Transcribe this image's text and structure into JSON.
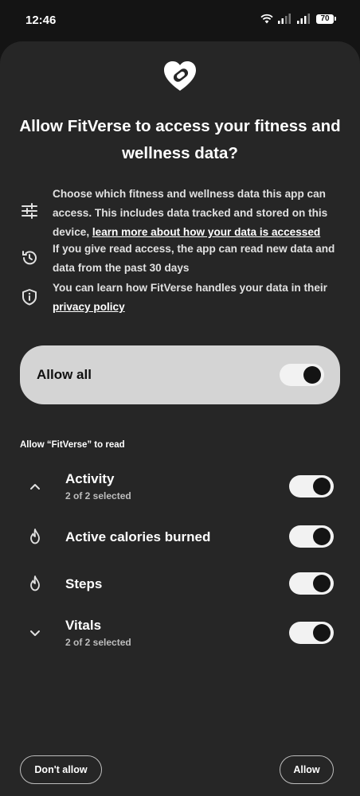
{
  "status_bar": {
    "time": "12:46",
    "battery_level": "70"
  },
  "dialog": {
    "title": "Allow FitVerse to access your fitness and wellness data?",
    "info": [
      {
        "icon": "sliders-icon",
        "text": "Choose which fitness and wellness data this app can access. This includes data tracked and stored on this device, ",
        "link": "learn more about how your data is accessed"
      },
      {
        "icon": "history-icon",
        "text": "If you give read access, the app can read new data and data from the past 30 days"
      },
      {
        "icon": "shield-icon",
        "text": "You can learn how FitVerse handles your data in their ",
        "link": "privacy policy"
      }
    ],
    "allow_all": {
      "label": "Allow all",
      "enabled": true
    },
    "section_label": "Allow “FitVerse” to read",
    "permissions": [
      {
        "icon": "chevron-up-icon",
        "title": "Activity",
        "subtitle": "2 of 2 selected",
        "enabled": true
      },
      {
        "icon": "flame-icon",
        "title": "Active calories burned",
        "subtitle": "",
        "enabled": true
      },
      {
        "icon": "flame-icon",
        "title": "Steps",
        "subtitle": "",
        "enabled": true
      },
      {
        "icon": "chevron-down-icon",
        "title": "Vitals",
        "subtitle": "2 of 2 selected",
        "enabled": true
      }
    ],
    "buttons": {
      "deny": "Don't allow",
      "allow": "Allow"
    }
  },
  "colors": {
    "background": "#141414",
    "sheet": "#262626",
    "allow_all_card": "#d4d4d4",
    "toggle_track": "#f2f2f2",
    "toggle_knob": "#141414"
  }
}
